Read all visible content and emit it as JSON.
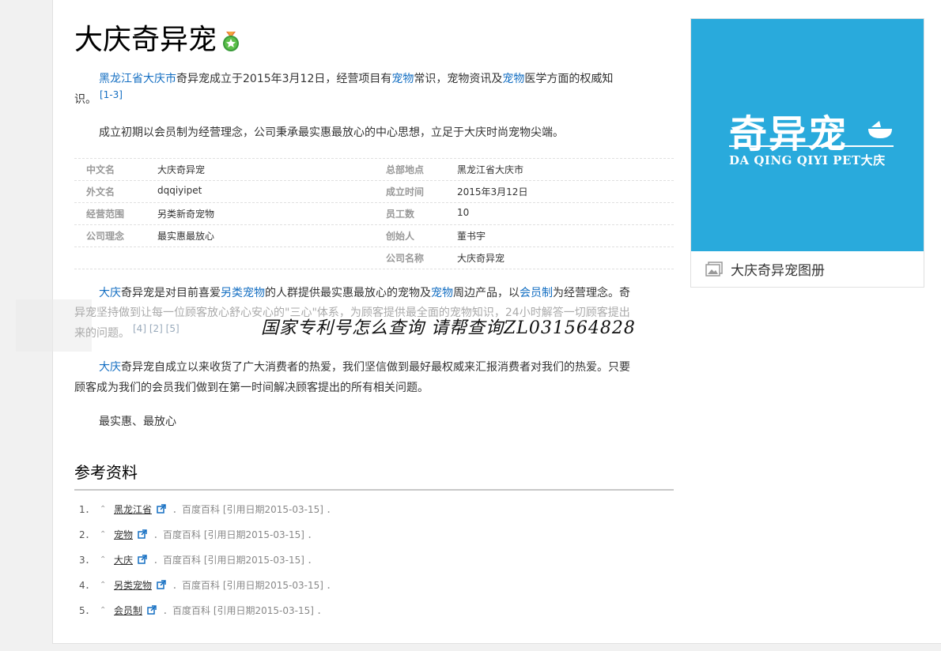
{
  "header": {
    "title": "大庆奇异宠"
  },
  "intro": {
    "link1": "黑龙江省",
    "link2": "大庆市",
    "t1": "奇异宠成立于2015年3月12日，经营项目有",
    "link3": "宠物",
    "t2": "常识，宠物资讯及",
    "link4": "宠物",
    "t3": "医学方面的权威知",
    "t4": "识。",
    "ref": "[1-3]"
  },
  "para2": "成立初期以会员制为经营理念，公司秉承最实惠最放心的中心思想，立足于大庆时尚宠物尖端。",
  "infobox": {
    "rows": [
      {
        "k1": "中文名",
        "v1": "大庆奇异宠",
        "k2": "总部地点",
        "v2": "黑龙江省大庆市"
      },
      {
        "k1": "外文名",
        "v1": "dqqiyipet",
        "k2": "成立时间",
        "v2": "2015年3月12日"
      },
      {
        "k1": "经营范围",
        "v1": "另类新奇宠物",
        "k2": "员工数",
        "v2": "10"
      },
      {
        "k1": "公司理念",
        "v1": "最实惠最放心",
        "k2": "创始人",
        "v2": "董书宇"
      },
      {
        "k1": "",
        "v1": "",
        "k2": "公司名称",
        "v2": "大庆奇异宠"
      }
    ]
  },
  "para3": {
    "link1": "大庆",
    "t1": "奇异宠是对目前喜爱",
    "link2": "另类宠物",
    "t2": "的人群提供最实惠最放心的宠物及",
    "link3": "宠物",
    "t3": "周边产品，以",
    "link4": "会员制",
    "t4": "为经营理念。奇",
    "line2": "异宠坚持做到让每一位顾客放心舒心安心的\"三心\"体系，为顾客提供最全面的宠物知识，24小时解答一切顾客提出",
    "line3": "来的问题。",
    "ref1": "[4]",
    "ref2": "[2]",
    "ref3": "[5]"
  },
  "watermark": "国家专利号怎么查询 请帮查询ZL031564828",
  "para4": {
    "link1": "大庆",
    "t1": "奇异宠自成立以来收货了广大消费者的热爱，我们坚信做到最好最权威来汇报消费者对我们的热爱。只要",
    "line2": "顾客成为我们的会员我们做到在第一时间解决顾客提出的所有相关问题。"
  },
  "para5": "最实惠、最放心",
  "album": {
    "logo_main": "奇异宠",
    "logo_sub": "DA QING QIYI PET大庆",
    "caption": "大庆奇异宠图册",
    "bg": "#29aadc"
  },
  "references": {
    "title": "参考资料",
    "items": [
      {
        "num": "1．",
        "title": "黑龙江省",
        "source": "．百度百科 [引用日期2015-03-15] ．"
      },
      {
        "num": "2．",
        "title": "宠物",
        "source": "．百度百科 [引用日期2015-03-15] ．"
      },
      {
        "num": "3．",
        "title": "大庆",
        "source": "．百度百科 [引用日期2015-03-15] ．"
      },
      {
        "num": "4．",
        "title": "另类宠物",
        "source": "．百度百科 [引用日期2015-03-15] ．"
      },
      {
        "num": "5．",
        "title": "会员制",
        "source": "．百度百科 [引用日期2015-03-15] ．"
      }
    ]
  }
}
